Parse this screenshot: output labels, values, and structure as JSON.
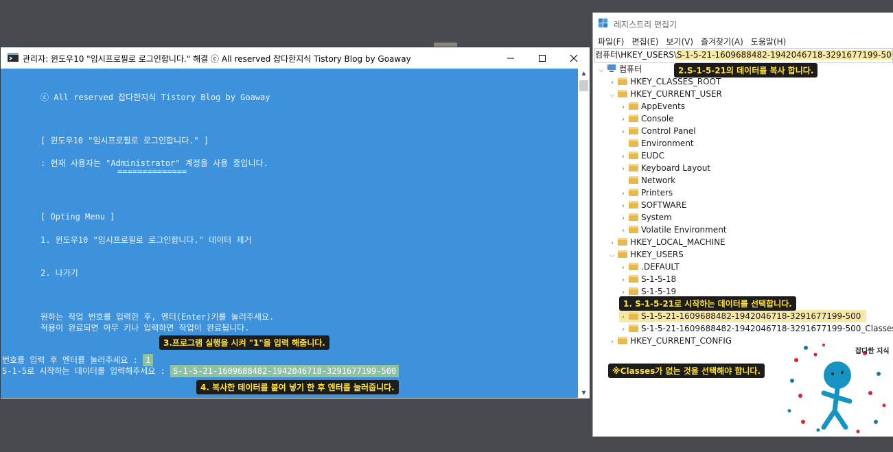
{
  "console": {
    "title": "관리자:  윈도우10 \"임시프로필로 로그인합니다.\" 해결 ⓒ All reserved 잡다한지식 Tistory Blog by Goaway",
    "lines": {
      "copyright": "ⓒ All reserved 잡다한지식 Tistory Blog by Goaway",
      "heading": "[ 윈도우10 \"임시프로필로 로그인합니다.\" ]",
      "current_user": ": 현재 사용자는 \"Administrator\" 계정을 사용 중입니다.",
      "underline": "==============",
      "menu_title": "[ Opting Menu ]",
      "option1": "1. 윈도우10 \"임시프로필로 로그인합니다.\" 데이터 제거",
      "option2": "2. 나가기",
      "instruction1": "원하는 작업 번호를 입력한 후, 엔터(Enter)키를 눌러주세요.",
      "instruction2": "적용이 완료되면 아무 키나 입력하면 작업이 완료됩니다.",
      "prompt1": "번호를 입력 후 엔터를 눌러주세요 : ",
      "prompt1_value": "1",
      "prompt2": "S-1-5로 시작하는 데이터를 입력해주세요 : ",
      "prompt2_value": "S-1-5-21-1609688482-1942046718-3291677199-500"
    },
    "background": "#3d92db"
  },
  "annotations": {
    "step3": "3.프로그램 실행을 시켜 \"1\"을 입력 해줍니다.",
    "step4": "4. 복사한 데이터를 붙여 넣기 한 후 엔터를 눌러줍니다.",
    "step2": "2.S-1-5-21의 데이터를 복사 합니다.",
    "step1": "1. S-1-5-21로 시작하는 데이터를 선택합니다.",
    "note": "※Classes가 없는 것을 선택해야 합니다.",
    "logo_text": "잡다한 지식"
  },
  "registry": {
    "title": "레지스트리 편집기",
    "menu": [
      "파일(F)",
      "편집(E)",
      "보기(V)",
      "즐겨찾기(A)",
      "도움말(H)"
    ],
    "address_prefix": "컴퓨터\\HKEY_USERS\\",
    "address_value": "S-1-5-21-1609688482-1942046718-3291677199-500",
    "tree": [
      {
        "label": "컴퓨터"
      },
      {
        "label": "HKEY_CLASSES_ROOT"
      },
      {
        "label": "HKEY_CURRENT_USER"
      },
      {
        "label": "AppEvents"
      },
      {
        "label": "Console"
      },
      {
        "label": "Control Panel"
      },
      {
        "label": "Environment"
      },
      {
        "label": "EUDC"
      },
      {
        "label": "Keyboard Layout"
      },
      {
        "label": "Network"
      },
      {
        "label": "Printers"
      },
      {
        "label": "SOFTWARE"
      },
      {
        "label": "System"
      },
      {
        "label": "Volatile Environment"
      },
      {
        "label": "HKEY_LOCAL_MACHINE"
      },
      {
        "label": "HKEY_USERS"
      },
      {
        "label": ".DEFAULT"
      },
      {
        "label": "S-1-5-18"
      },
      {
        "label": "S-1-5-19"
      },
      {
        "label": "S-1-5-21-1609688482-1942046718-3291677199-500"
      },
      {
        "label": "S-1-5-21-1609688482-1942046718-3291677199-500_Classes"
      },
      {
        "label": "HKEY_CURRENT_CONFIG"
      }
    ]
  },
  "colors": {
    "highlight": "#f6e9a7",
    "annotation_text": "#ffe13a",
    "desktop": "#474b4f"
  }
}
